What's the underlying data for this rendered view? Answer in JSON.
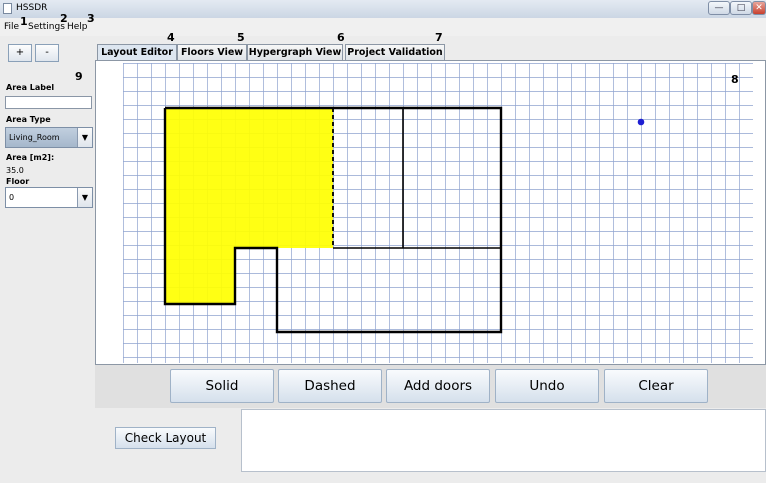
{
  "window": {
    "title": "HSSDR",
    "minimize_glyph": "—",
    "maximize_glyph": "□",
    "close_glyph": "✕"
  },
  "menu": [
    "File",
    "Settings",
    "Help"
  ],
  "markers": [
    "1",
    "2",
    "3",
    "4",
    "5",
    "6",
    "7",
    "8",
    "9"
  ],
  "left_panel": {
    "plus_label": "+",
    "minus_label": "-",
    "area_label_title": "Area Label",
    "area_label_value": "",
    "area_type_title": "Area Type",
    "area_type_value": "Living_Room",
    "area_m2_title": "Area [m2]:",
    "area_m2_value": "35.0",
    "floor_title": "Floor",
    "floor_value": "0",
    "dropdown_glyph": "▼"
  },
  "tabs": [
    "Layout Editor",
    "Floors View",
    "Hypergraph View",
    "Project Validation"
  ],
  "active_tab": "Layout Editor",
  "toolbar": [
    "Solid",
    "Dashed",
    "Add doors",
    "Undo",
    "Clear"
  ],
  "check_button": "Check Layout",
  "colors": {
    "grid_line": "#8fa3cf",
    "room_fill": "#ffff00",
    "wall": "#000000",
    "point": "#1e1ed2",
    "selected_combo": "#aabbd0"
  },
  "icons": [
    "app-icon",
    "dropdown-arrow-icon",
    "point-marker-icon"
  ]
}
